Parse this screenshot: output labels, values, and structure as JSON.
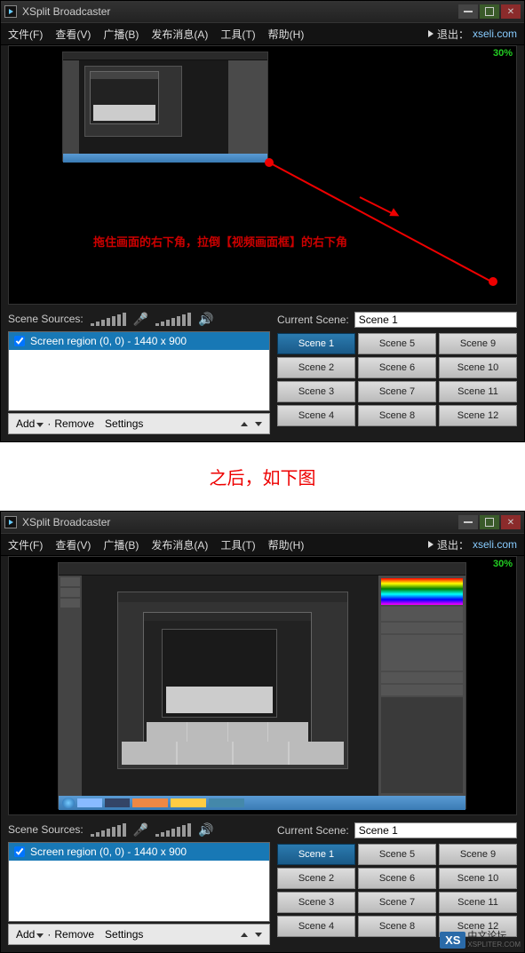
{
  "app": {
    "title": "XSplit Broadcaster"
  },
  "menu": {
    "file": "文件(F)",
    "view": "查看(V)",
    "broadcast": "广播(B)",
    "publish": "发布消息(A)",
    "tools": "工具(T)",
    "help": "帮助(H)",
    "exit_label": "退出：",
    "exit_link": "xseli.com"
  },
  "preview": {
    "percent": "30%",
    "annotation": "拖住画面的右下角，拉倒【视频画面框】的右下角"
  },
  "audio": {
    "sources_label": "Scene Sources:"
  },
  "source": {
    "item": "Screen region (0, 0) - 1440 x 900"
  },
  "src_buttons": {
    "add": "Add",
    "remove": "Remove",
    "settings": "Settings"
  },
  "current_scene": {
    "label": "Current Scene:",
    "value": "Scene 1"
  },
  "scenes": {
    "s1": "Scene 1",
    "s2": "Scene 2",
    "s3": "Scene 3",
    "s4": "Scene 4",
    "s5": "Scene 5",
    "s6": "Scene 6",
    "s7": "Scene 7",
    "s8": "Scene 8",
    "s9": "Scene 9",
    "s10": "Scene 10",
    "s11": "Scene 11",
    "s12": "Scene 12"
  },
  "separator_text": "之后，如下图",
  "watermark": {
    "badge": "XS",
    "line1": "中文论坛",
    "line2": "XSPLITER.COM"
  }
}
